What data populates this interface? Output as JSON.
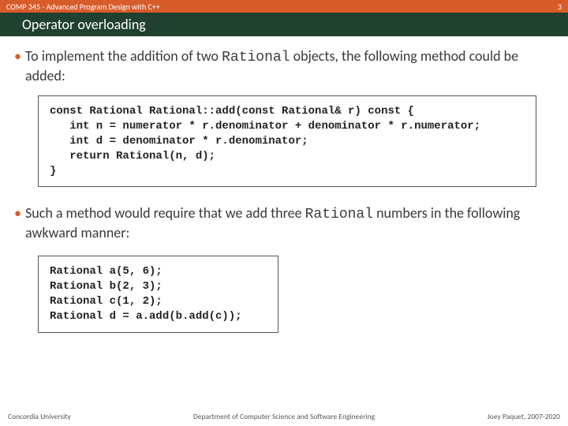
{
  "header": {
    "course": "COMP 345 - Advanced Program Design with C++",
    "page_number": "3"
  },
  "title": "Operator overloading",
  "bullets": {
    "b1_pre": "To implement the addition of two ",
    "b1_mono": "Rational",
    "b1_post": " objects, the following method could be added:",
    "b2_pre": "Such a method would require that we add three ",
    "b2_mono": "Rational",
    "b2_post": " numbers in the following awkward manner:"
  },
  "code": {
    "block1": "const Rational Rational::add(const Rational& r) const {\n   int n = numerator * r.denominator + denominator * r.numerator;\n   int d = denominator * r.denominator;\n   return Rational(n, d);\n}",
    "block2": "Rational a(5, 6);\nRational b(2, 3);\nRational c(1, 2);\nRational d = a.add(b.add(c));"
  },
  "footer": {
    "left": "Concordia University",
    "center": "Department of Computer Science and Software Engineering",
    "right": "Joey Paquet, 2007-2020"
  }
}
